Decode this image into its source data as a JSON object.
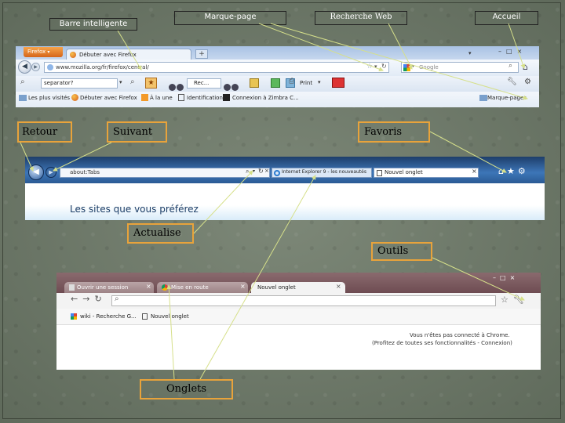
{
  "labels": {
    "smart_bar": "Barre intelligente",
    "bookmark": "Marque-page",
    "web_search": "Recherche Web",
    "home": "Accueil",
    "back": "Retour",
    "forward": "Suivant",
    "favorites": "Favoris",
    "refresh": "Actualise",
    "tools": "Outils",
    "tabs": "Onglets"
  },
  "firefox": {
    "app_button": "Firefox",
    "tab_title": "Débuter avec Firefox",
    "new_tab_symbol": "+",
    "url": "www.mozilla.org/fr/firefox/central/",
    "search_engine": "Google",
    "search_field": "separator?",
    "zoom_field": "Rec...",
    "print_label": "Print",
    "bookmarks_bar": [
      "Les plus visités",
      "Débuter avec Firefox",
      "À la une",
      "Identification",
      "Connexion à Zimbra C..."
    ],
    "bookmarks_menu": "Marque-pages"
  },
  "ie": {
    "url": "about:Tabs",
    "tab1": "Internet Explorer 9 - les nouveautés",
    "tab2": "Nouvel onglet",
    "heading": "Les sites que vous préférez"
  },
  "chrome": {
    "tab1": "Ouvrir une session",
    "tab2": "Mise en route",
    "tab3": "Nouvel onglet",
    "bookmark1": "wiki - Recherche G...",
    "bookmark2": "Nouvel onglet",
    "message_line1": "Vous n'êtes pas connecté à Chrome.",
    "message_line2": "(Profitez de toutes ses fonctionnalités - Connexion)"
  },
  "colors": {
    "callout_orange": "#e8a33b",
    "background": "#6b7667",
    "arrow": "#d6e08a",
    "ie_blue": "#2a7bd0"
  }
}
